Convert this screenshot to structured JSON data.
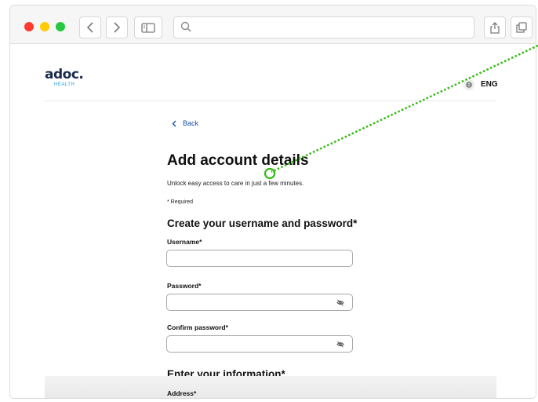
{
  "browser": {
    "icons": [
      "back-icon",
      "forward-icon",
      "sidebar-icon",
      "search-icon",
      "share-icon",
      "tabs-icon"
    ]
  },
  "header": {
    "logo_main": "adoc.",
    "logo_sub": "HEALTH",
    "language": "ENG"
  },
  "nav": {
    "back_label": "Back"
  },
  "page": {
    "title": "Add account details",
    "subtitle": "Unlock easy access to care in just a few minutes.",
    "required_note": "* Required"
  },
  "credentials": {
    "section_title": "Create your username and password*",
    "username_label": "Username*",
    "username_value": "",
    "password_label": "Password*",
    "password_value": "",
    "confirm_label": "Confirm password*",
    "confirm_value": ""
  },
  "info": {
    "section_title": "Enter your information*",
    "address_label": "Address*"
  },
  "colors": {
    "link": "#1a4fa3",
    "logo": "#1a2b4c",
    "logo_accent": "#2d9adf",
    "pointer": "#33bb11"
  }
}
